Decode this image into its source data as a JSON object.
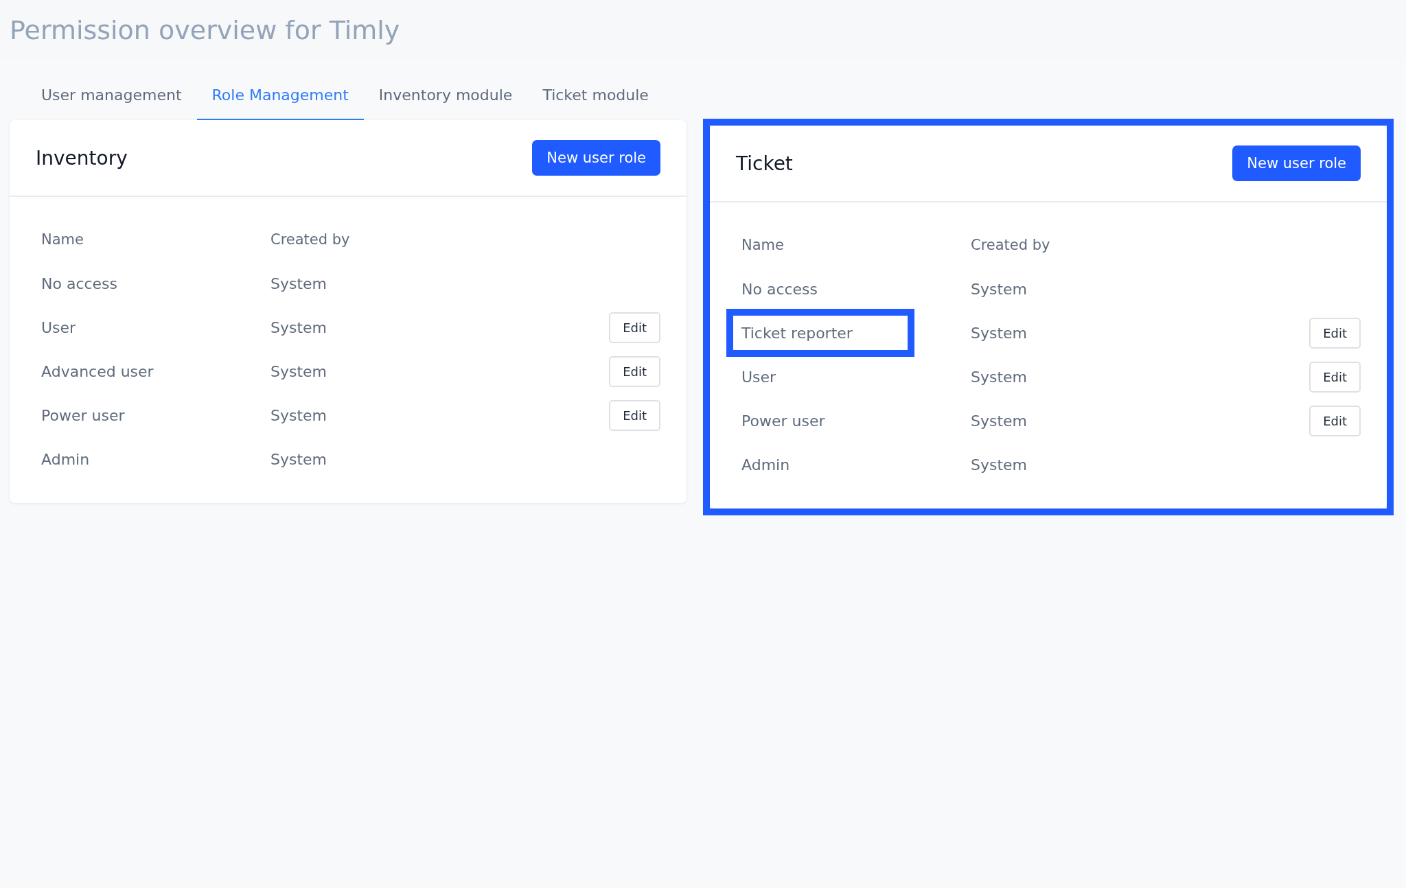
{
  "page_title": "Permission overview for Timly",
  "tabs": [
    {
      "label": "User management",
      "selected": false
    },
    {
      "label": "Role Management",
      "selected": true
    },
    {
      "label": "Inventory module",
      "selected": false
    },
    {
      "label": "Ticket module",
      "selected": false
    }
  ],
  "panels": [
    {
      "title": "Inventory",
      "button": "New user role",
      "highlighted": false,
      "columns": [
        "Name",
        "Created by"
      ],
      "rows": [
        {
          "name": "No access",
          "created_by": "System",
          "highlighted": false
        },
        {
          "name": "User",
          "created_by": "System",
          "action": "Edit",
          "highlighted": false
        },
        {
          "name": "Advanced user",
          "created_by": "System",
          "action": "Edit",
          "highlighted": false
        },
        {
          "name": "Power user",
          "created_by": "System",
          "action": "Edit",
          "highlighted": false
        },
        {
          "name": "Admin",
          "created_by": "System",
          "highlighted": false
        }
      ]
    },
    {
      "title": "Ticket",
      "button": "New user role",
      "highlighted": true,
      "columns": [
        "Name",
        "Created by"
      ],
      "rows": [
        {
          "name": "No access",
          "created_by": "System",
          "highlighted": false
        },
        {
          "name": "Ticket reporter",
          "created_by": "System",
          "action": "Edit",
          "highlighted": true
        },
        {
          "name": "User",
          "created_by": "System",
          "action": "Edit",
          "highlighted": false
        },
        {
          "name": "Power user",
          "created_by": "System",
          "action": "Edit",
          "highlighted": false
        },
        {
          "name": "Admin",
          "created_by": "System",
          "highlighted": false
        }
      ]
    }
  ]
}
